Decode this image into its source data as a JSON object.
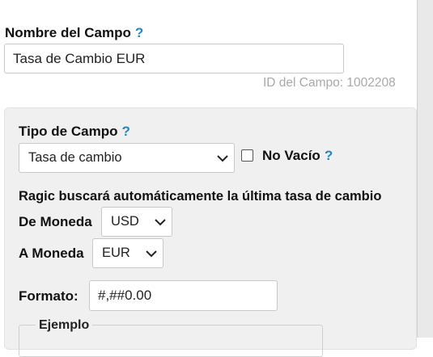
{
  "field_name": {
    "label": "Nombre del Campo",
    "help": "?",
    "value": "Tasa de Cambio EUR",
    "field_id": "ID del Campo: 1002208"
  },
  "field_type": {
    "label": "Tipo de Campo",
    "help": "?",
    "selected": "Tasa de cambio",
    "not_empty_label": "No Vacío",
    "not_empty_help": "?",
    "not_empty_checked": false
  },
  "exchange": {
    "description": "Ragic buscará automáticamente la última tasa de cambio",
    "from_label": "De Moneda",
    "from_value": "USD",
    "to_label": "A Moneda",
    "to_value": "EUR"
  },
  "format": {
    "label": "Formato:",
    "value": "#,##0.00"
  },
  "example": {
    "legend": "Ejemplo"
  }
}
